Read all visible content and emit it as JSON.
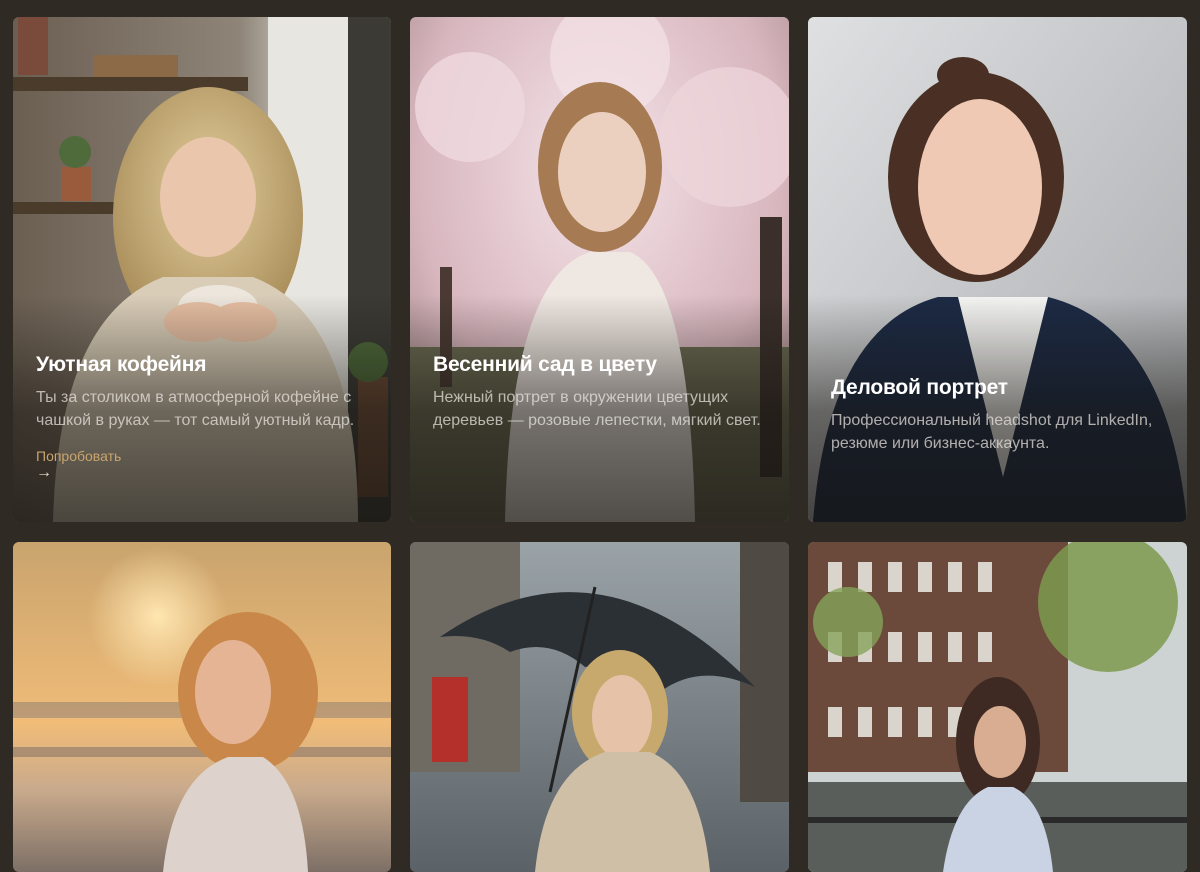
{
  "cards": [
    {
      "title": "Уютная кофейня",
      "description": "Ты за столиком в атмосферной кофейне с чашкой в руках — тот самый уютный кадр.",
      "cta_label": "Попробовать",
      "cta_arrow": "→"
    },
    {
      "title": "Весенний сад в цвету",
      "description": "Нежный портрет в окружении цветущих деревьев — розовые лепестки, мягкий свет."
    },
    {
      "title": "Деловой портрет",
      "description": "Профессиональный headshot для LinkedIn, резюме или бизнес-аккаунта."
    },
    {
      "scene": "sunset-beach-portrait"
    },
    {
      "scene": "rain-umbrella-portrait"
    },
    {
      "scene": "canal-street-portrait"
    }
  ],
  "colors": {
    "page_background": "#2f2b24",
    "cta_accent": "#c9a46c",
    "title": "#ffffff"
  }
}
